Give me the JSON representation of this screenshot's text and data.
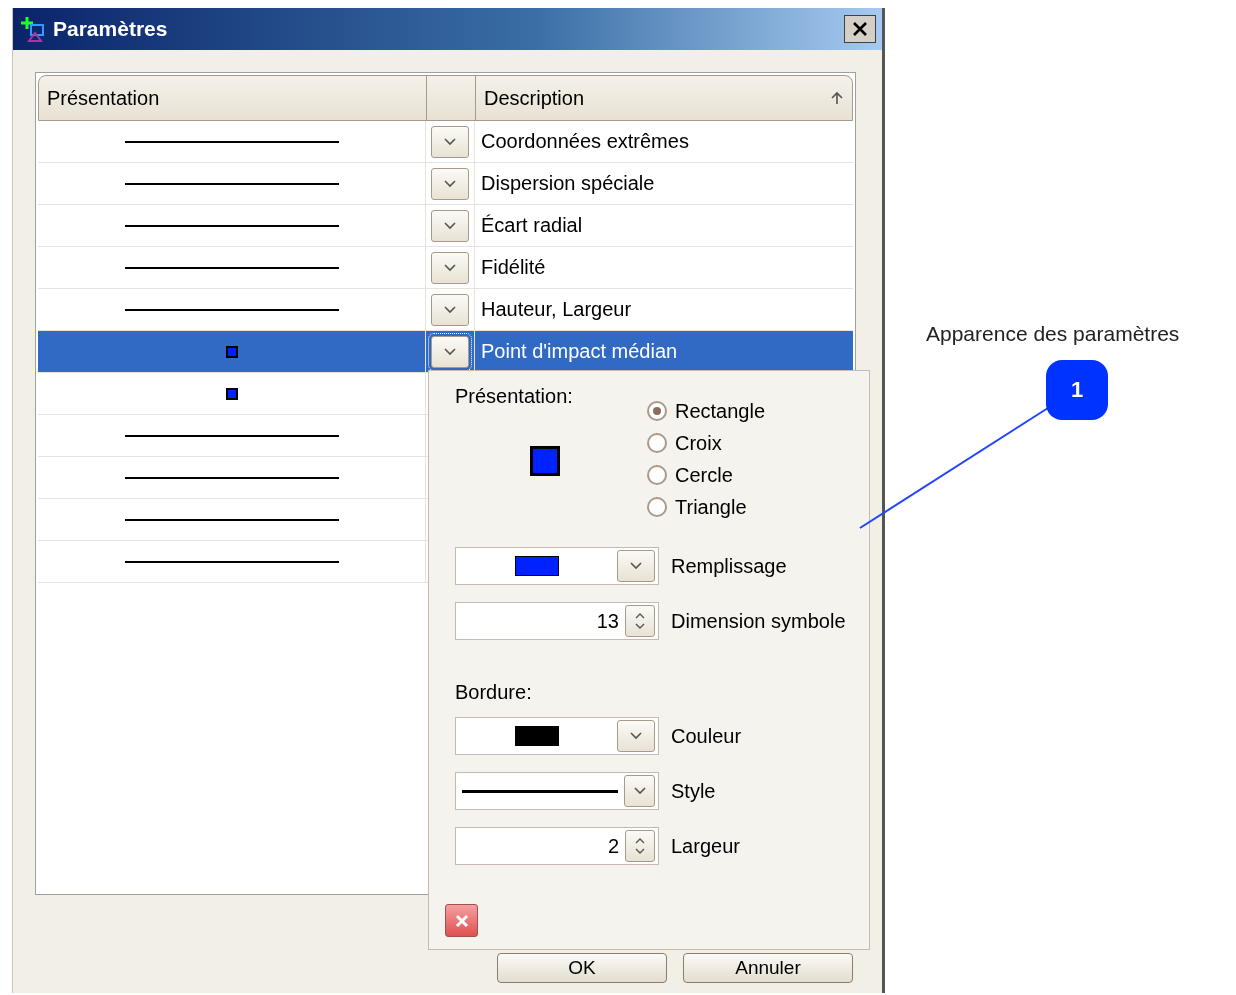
{
  "window": {
    "title": "Paramètres"
  },
  "table": {
    "columns": [
      {
        "label": "Présentation",
        "sorted": false
      },
      {
        "label": "Description",
        "sorted": true
      }
    ],
    "rows": [
      {
        "kind": "line",
        "description": "Coordonnées extrêmes",
        "selected": false
      },
      {
        "kind": "line",
        "description": "Dispersion spéciale",
        "selected": false
      },
      {
        "kind": "line",
        "description": "Écart radial",
        "selected": false
      },
      {
        "kind": "line",
        "description": "Fidélité",
        "selected": false
      },
      {
        "kind": "line",
        "description": "Hauteur, Largeur",
        "selected": false
      },
      {
        "kind": "square",
        "description": "Point d'impact médian",
        "selected": true
      },
      {
        "kind": "square",
        "selected": false
      },
      {
        "kind": "line",
        "selected": false
      },
      {
        "kind": "line",
        "selected": false
      },
      {
        "kind": "line",
        "selected": false
      },
      {
        "kind": "line",
        "selected": false
      }
    ]
  },
  "popup": {
    "presentation_label": "Présentation:",
    "shapes": [
      {
        "label": "Rectangle",
        "selected": true
      },
      {
        "label": "Croix",
        "selected": false
      },
      {
        "label": "Cercle",
        "selected": false
      },
      {
        "label": "Triangle",
        "selected": false
      }
    ],
    "fill": {
      "color": "#0022ff",
      "label": "Remplissage"
    },
    "size": {
      "value": "13",
      "label": "Dimension symbole"
    },
    "border_label": "Bordure:",
    "border_color": {
      "color": "#000000",
      "label": "Couleur"
    },
    "border_style": {
      "label": "Style"
    },
    "border_width": {
      "value": "2",
      "label": "Largeur"
    }
  },
  "buttons": [
    "OK",
    "Annuler"
  ],
  "annotation": {
    "text": "Apparence des paramètres",
    "badge": "1"
  }
}
